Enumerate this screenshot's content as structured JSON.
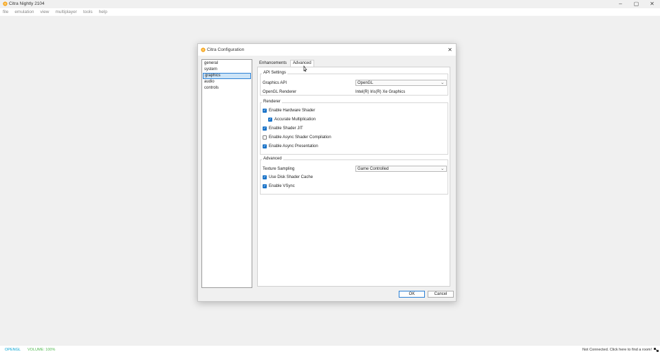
{
  "window": {
    "title": "Citra Nightly 2104",
    "minimize": "–",
    "maximize": "▢",
    "close": "✕"
  },
  "menu": [
    "file",
    "emulation",
    "view",
    "multiplayer",
    "tools",
    "help"
  ],
  "status": {
    "api": "OPENGL",
    "volume": "VOLUME: 100%",
    "room": "Not Connected. Click here to find a room!"
  },
  "dialog": {
    "title": "Citra Configuration",
    "close": "✕",
    "categories": [
      "general",
      "system",
      "graphics",
      "audio",
      "controls"
    ],
    "selected_category": "graphics",
    "tabs": [
      "Enhancements",
      "Advanced"
    ],
    "active_tab": "Advanced",
    "api_settings": {
      "title": "API Settings",
      "graphics_api_label": "Graphics API",
      "graphics_api_value": "OpenGL",
      "renderer_label": "OpenGL Renderer",
      "renderer_value": "Intel(R) Iris(R) Xe Graphics"
    },
    "renderer": {
      "title": "Renderer",
      "options": [
        {
          "label": "Enable Hardware Shader",
          "checked": true
        },
        {
          "label": "Accurate Multiplication",
          "checked": true
        },
        {
          "label": "Enable Shader JIT",
          "checked": true
        },
        {
          "label": "Enable Async Shader Compilation",
          "checked": false
        },
        {
          "label": "Enable Async Presentation",
          "checked": true
        }
      ]
    },
    "advanced": {
      "title": "Advanced",
      "texture_label": "Texture Sampling",
      "texture_value": "Game Controlled",
      "options": [
        {
          "label": "Use Disk Shader Cache",
          "checked": true
        },
        {
          "label": "Enable VSync",
          "checked": true
        }
      ]
    },
    "ok": "OK",
    "cancel": "Cancel"
  },
  "colors": {
    "accent": "#1a73c8",
    "api_status": "#00a2d2",
    "volume_status": "#4fb94f"
  }
}
